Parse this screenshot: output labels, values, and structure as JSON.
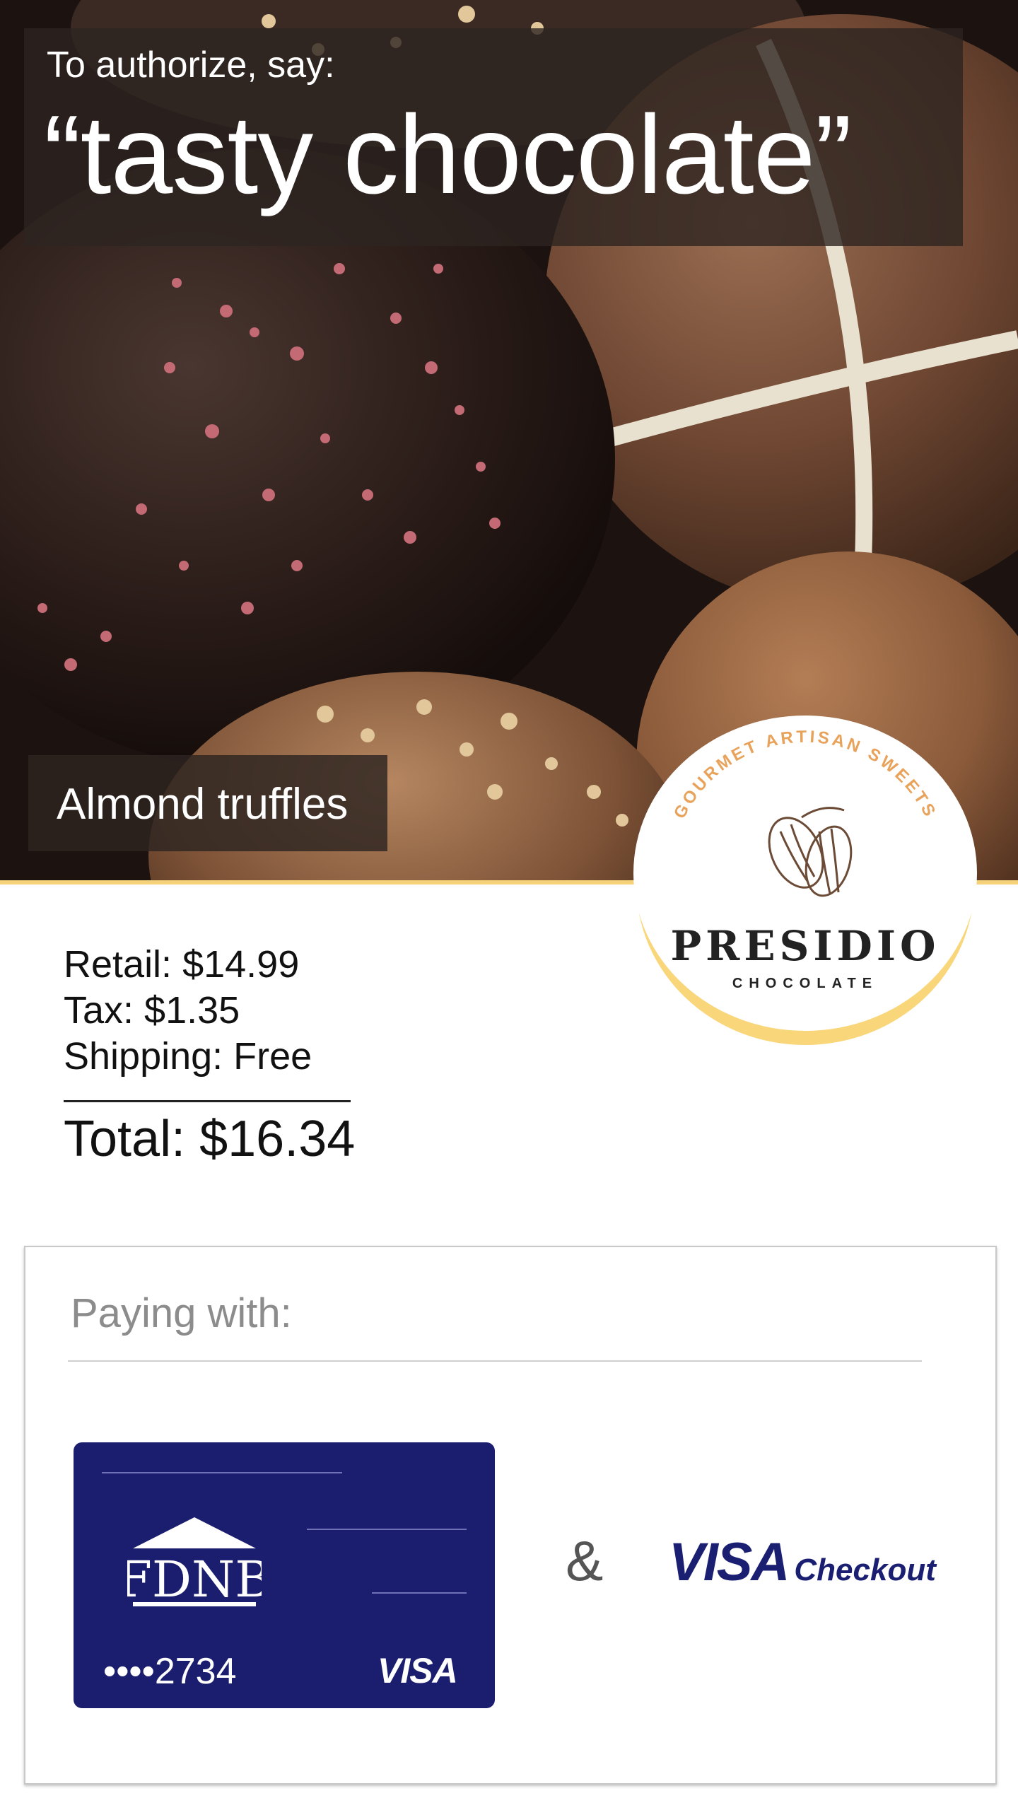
{
  "auth": {
    "label": "To authorize, say:",
    "phrase": "“tasty chocolate”"
  },
  "product": {
    "name": "Almond truffles"
  },
  "brand": {
    "arc_text": "GOURMET ARTISAN SWEETS",
    "name": "PRESIDIO",
    "subtitle": "CHOCOLATE",
    "icon": "cacao-pod-icon"
  },
  "pricing": {
    "retail": "Retail: $14.99",
    "tax": "Tax: $1.35",
    "shipping": "Shipping: Free",
    "total": "Total: $16.34"
  },
  "payment": {
    "label": "Paying with:",
    "card": {
      "bank": "FDNB",
      "number": "••••2734",
      "network": "VISA",
      "color": "#1b1d6e"
    },
    "connector": "&",
    "wallet": {
      "visa": "VISA",
      "checkout": "Checkout",
      "color": "#1a1f71"
    }
  },
  "colors": {
    "accent_gold": "#f5d27a",
    "arc_orange": "#e8a25a"
  }
}
